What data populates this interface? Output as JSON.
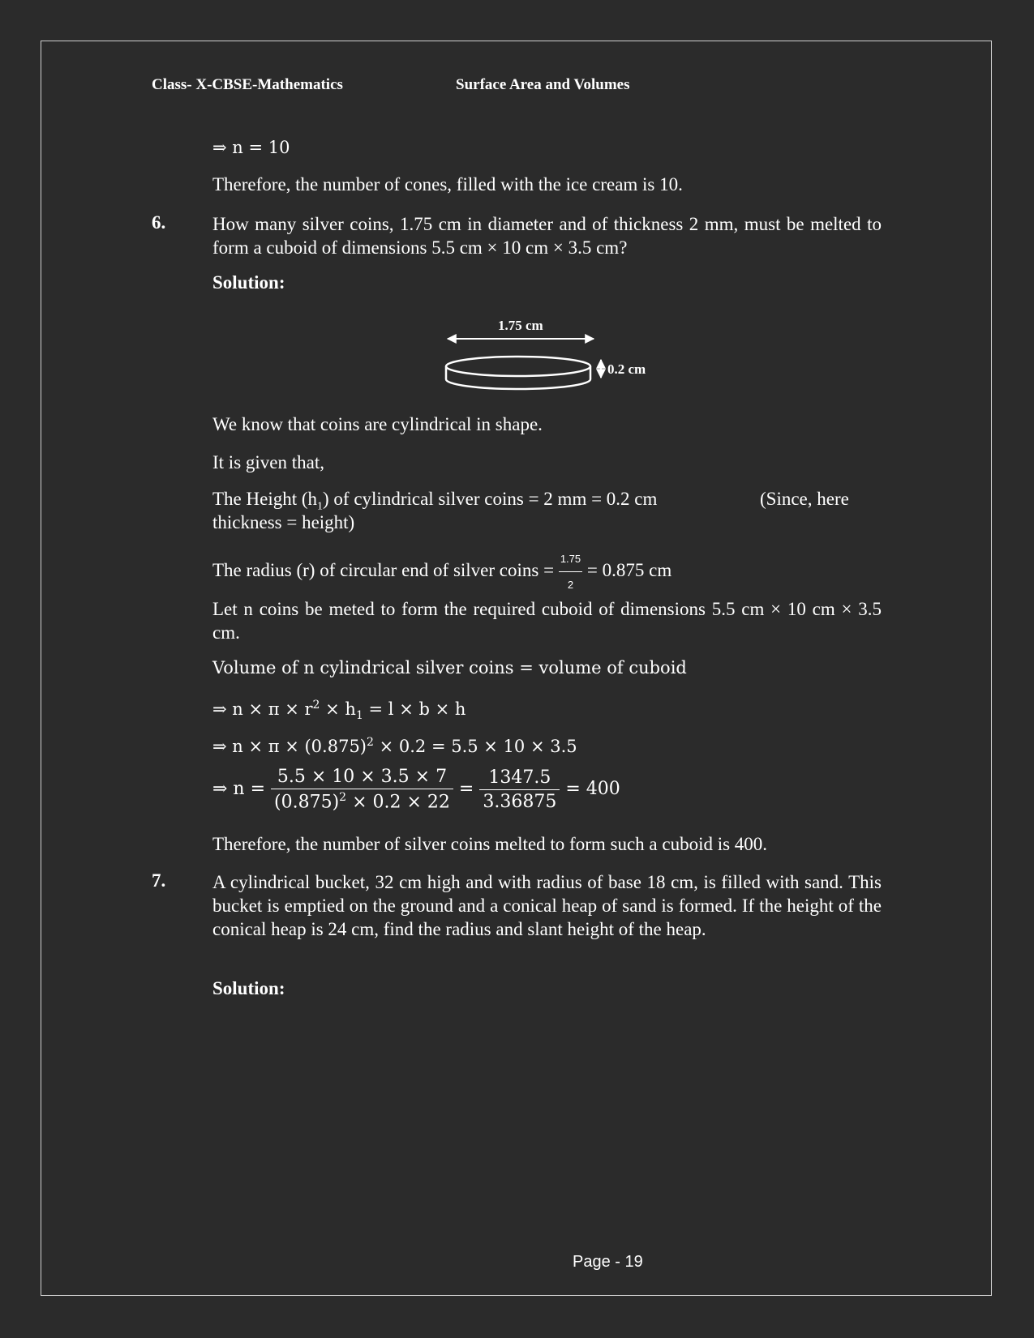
{
  "header": {
    "left": "Class- X-CBSE-Mathematics",
    "center": "Surface Area and Volumes"
  },
  "lines": {
    "n_eq_10": "⇒ n = 10",
    "therefore_cones": "Therefore, the number of cones, filled with the ice cream is 10."
  },
  "q6": {
    "number": "6.",
    "text": "How many silver coins, 1.75 cm in diameter and of thickness 2 mm, must be melted to form a cuboid of dimensions 5.5 cm × 10 cm × 3.5 cm?",
    "solution_label": "Solution:",
    "figure": {
      "diameter_label": "1.75 cm",
      "thickness_label": "0.2 cm"
    },
    "cylindrical": "We know that coins are cylindrical in shape.",
    "given": "It is given that,",
    "height": {
      "pre": "The Height (h",
      "sub": "1",
      "post": ") of cylindrical silver coins = 2 mm = 0.2 cm",
      "note": "(Since, here",
      "cont": "thickness = height)"
    },
    "radius": {
      "pre": "The radius (r) of circular end of silver coins = ",
      "num": "1.75",
      "den": "2",
      "post": " = 0.875 cm"
    },
    "let_n": "Let n coins be meted to form the required cuboid of dimensions 5.5 cm × 10 cm × 3.5 cm.",
    "volume_eq": "Volume of n cylindrical silver coins = volume of cuboid",
    "eq1": {
      "pre": "⇒ n × π × r",
      "sup": "2",
      "mid": " × h",
      "sub": "1",
      "post": " = l × b × h"
    },
    "eq2": {
      "pre": "⇒ n × π × (0.875)",
      "sup": "2",
      "post": " × 0.2 = 5.5 × 10 × 3.5"
    },
    "eq3": {
      "pre": "⇒ n = ",
      "num1": "5.5 × 10 × 3.5 × 7",
      "den1_pre": "(0.875)",
      "den1_sup": "2",
      "den1_post": " × 0.2 × 22",
      "eq": " = ",
      "num2": "1347.5",
      "den2": "3.36875",
      "post": " = 400"
    },
    "therefore": "Therefore, the number of silver coins melted to form such a cuboid is 400."
  },
  "q7": {
    "number": "7.",
    "text": "A cylindrical bucket, 32 cm high and with radius of base 18 cm, is filled with sand. This bucket is emptied on the ground and a conical heap of sand is formed. If the height of the conical heap is 24 cm, find the radius and slant height of the heap.",
    "solution_label": "Solution:"
  },
  "footer": {
    "page": "Page - 19"
  }
}
